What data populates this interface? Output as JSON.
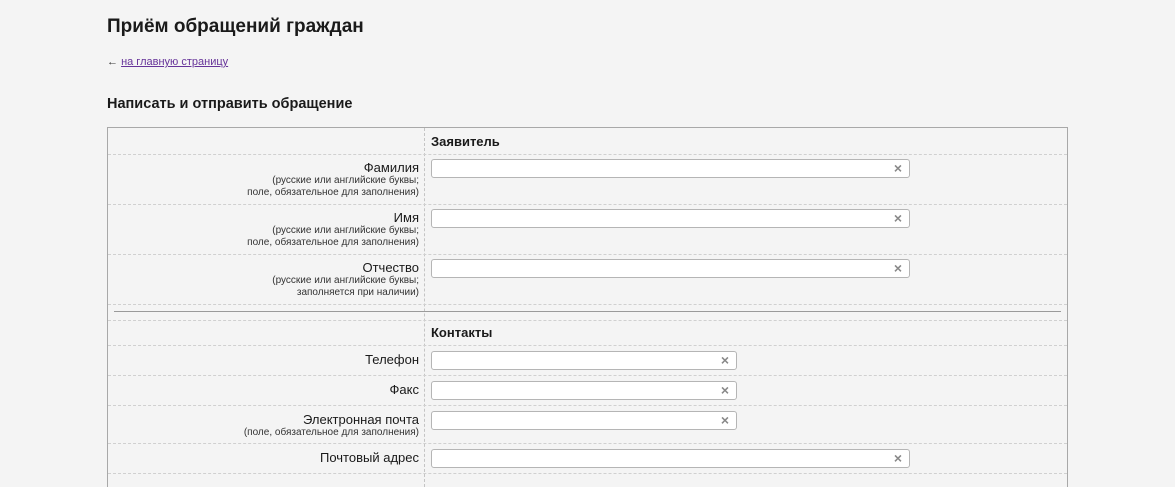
{
  "page": {
    "title": "Приём обращений граждан",
    "back_arrow": "←",
    "back_link": "на главную страницу",
    "section_title": "Написать и отправить обращение"
  },
  "applicant": {
    "title": "Заявитель",
    "surname": {
      "label": "Фамилия",
      "hint1": "(русские или английские буквы;",
      "hint2": "поле, обязательное для заполнения)",
      "value": ""
    },
    "name": {
      "label": "Имя",
      "hint1": "(русские или английские буквы;",
      "hint2": "поле, обязательное для заполнения)",
      "value": ""
    },
    "patronymic": {
      "label": "Отчество",
      "hint1": "(русские или английские буквы;",
      "hint2": "заполняется при наличии)",
      "value": ""
    }
  },
  "contacts": {
    "title": "Контакты",
    "phone": {
      "label": "Телефон",
      "value": ""
    },
    "fax": {
      "label": "Факс",
      "value": ""
    },
    "email": {
      "label": "Электронная почта",
      "hint": "(поле, обязательное для заполнения)",
      "value": ""
    },
    "postal": {
      "label": "Почтовый адрес",
      "value": ""
    }
  },
  "icons": {
    "clear": "clear-icon"
  },
  "colors": {
    "link": "#663399",
    "background": "#f4f4f4",
    "border": "#a8a8a8"
  }
}
